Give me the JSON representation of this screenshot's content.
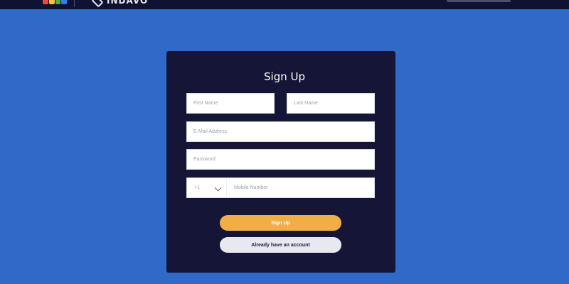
{
  "colors": {
    "background": "#3169c9",
    "topbar": "#0f1233",
    "card": "#151637",
    "primary_button": "#f2ad45",
    "secondary_button": "#e8e8f1"
  },
  "topbar": {
    "brand_text": "INDAVO",
    "logo_colors": [
      "#e84a3b",
      "#f6c244",
      "#4caf50",
      "#2f80ed"
    ]
  },
  "form": {
    "title": "Sign Up",
    "first_name_placeholder": "First Name",
    "last_name_placeholder": "Last Name",
    "email_placeholder": "E-Mail Address",
    "password_placeholder": "Password",
    "country_code": "+1",
    "mobile_placeholder": "Mobile Number",
    "signup_label": "Sign Up",
    "account_label": "Already have an account"
  }
}
